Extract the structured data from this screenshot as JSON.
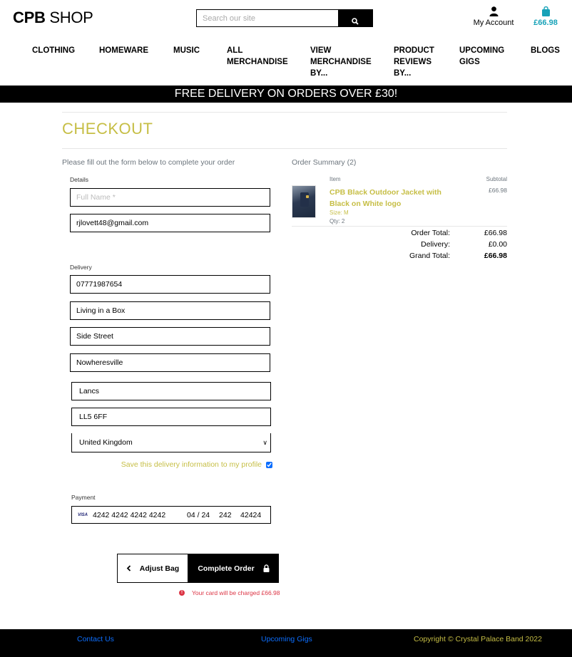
{
  "header": {
    "logo_bold": "CPB",
    "logo_light": " SHOP",
    "search_placeholder": "Search our site",
    "account_label": "My Account",
    "bag_total": "£66.98"
  },
  "nav": [
    {
      "label": "Clothing"
    },
    {
      "label": "Homeware"
    },
    {
      "label": "Music"
    },
    {
      "label": "All Merchandise"
    },
    {
      "label": "View Merchandise By..."
    },
    {
      "label": "Product Reviews By..."
    },
    {
      "label": "Upcoming Gigs"
    },
    {
      "label": "Blogs"
    }
  ],
  "banner": "FREE DELIVERY ON ORDERS OVER £30!",
  "page_title": "CHECKOUT",
  "form": {
    "intro": "Please fill out the form below to complete your order",
    "details_label": "Details",
    "full_name_placeholder": "Full Name *",
    "email": "rjlovett48@gmail.com",
    "delivery_label": "Delivery",
    "phone": "07771987654",
    "street1": "Living in a Box",
    "street2": "Side Street",
    "town": "Nowheresville",
    "county": "Lancs",
    "postcode": "LL5 6FF",
    "country": "United Kingdom",
    "save_info_label": "Save this delivery information to my profile",
    "save_info_checked": true,
    "payment_label": "Payment",
    "card_brand": "VISA",
    "card_number": "4242 4242 4242 4242",
    "card_expiry": "04 / 24",
    "card_cvc": "242",
    "card_zip": "42424"
  },
  "buttons": {
    "adjust_bag": "Adjust Bag",
    "complete_order": "Complete Order"
  },
  "charge_notice": "Your card will be charged £66.98",
  "summary": {
    "title": "Order Summary (2)",
    "col_item": "Item",
    "col_subtotal": "Subtotal",
    "items": [
      {
        "name": "CPB Black Outdoor Jacket with Black on White logo",
        "size": "Size: M",
        "qty": "Qty: 2",
        "subtotal": "£66.98"
      }
    ],
    "order_total_label": "Order Total:",
    "order_total": "£66.98",
    "delivery_label": "Delivery:",
    "delivery": "£0.00",
    "grand_total_label": "Grand Total:",
    "grand_total": "£66.98"
  },
  "footer": {
    "contact": "Contact Us",
    "gigs": "Upcoming Gigs",
    "copyright": "Copyright © Crystal Palace Band 2022"
  },
  "colors": {
    "accent": "#c6be45",
    "bag": "#17a2b8",
    "link": "#0d6efd",
    "danger": "#dc3545"
  }
}
